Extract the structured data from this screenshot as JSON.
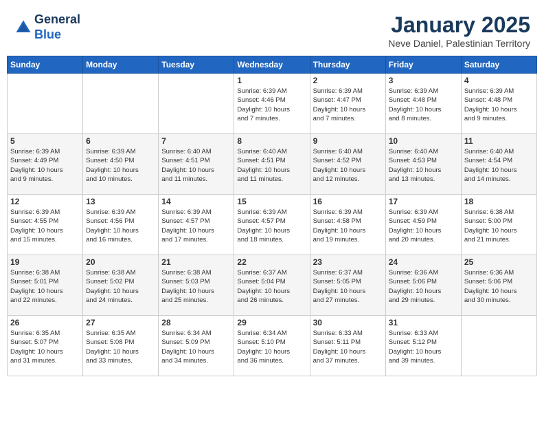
{
  "header": {
    "logo_line1": "General",
    "logo_line2": "Blue",
    "month": "January 2025",
    "location": "Neve Daniel, Palestinian Territory"
  },
  "weekdays": [
    "Sunday",
    "Monday",
    "Tuesday",
    "Wednesday",
    "Thursday",
    "Friday",
    "Saturday"
  ],
  "weeks": [
    [
      {
        "day": "",
        "info": ""
      },
      {
        "day": "",
        "info": ""
      },
      {
        "day": "",
        "info": ""
      },
      {
        "day": "1",
        "info": "Sunrise: 6:39 AM\nSunset: 4:46 PM\nDaylight: 10 hours\nand 7 minutes."
      },
      {
        "day": "2",
        "info": "Sunrise: 6:39 AM\nSunset: 4:47 PM\nDaylight: 10 hours\nand 7 minutes."
      },
      {
        "day": "3",
        "info": "Sunrise: 6:39 AM\nSunset: 4:48 PM\nDaylight: 10 hours\nand 8 minutes."
      },
      {
        "day": "4",
        "info": "Sunrise: 6:39 AM\nSunset: 4:48 PM\nDaylight: 10 hours\nand 9 minutes."
      }
    ],
    [
      {
        "day": "5",
        "info": "Sunrise: 6:39 AM\nSunset: 4:49 PM\nDaylight: 10 hours\nand 9 minutes."
      },
      {
        "day": "6",
        "info": "Sunrise: 6:39 AM\nSunset: 4:50 PM\nDaylight: 10 hours\nand 10 minutes."
      },
      {
        "day": "7",
        "info": "Sunrise: 6:40 AM\nSunset: 4:51 PM\nDaylight: 10 hours\nand 11 minutes."
      },
      {
        "day": "8",
        "info": "Sunrise: 6:40 AM\nSunset: 4:51 PM\nDaylight: 10 hours\nand 11 minutes."
      },
      {
        "day": "9",
        "info": "Sunrise: 6:40 AM\nSunset: 4:52 PM\nDaylight: 10 hours\nand 12 minutes."
      },
      {
        "day": "10",
        "info": "Sunrise: 6:40 AM\nSunset: 4:53 PM\nDaylight: 10 hours\nand 13 minutes."
      },
      {
        "day": "11",
        "info": "Sunrise: 6:40 AM\nSunset: 4:54 PM\nDaylight: 10 hours\nand 14 minutes."
      }
    ],
    [
      {
        "day": "12",
        "info": "Sunrise: 6:39 AM\nSunset: 4:55 PM\nDaylight: 10 hours\nand 15 minutes."
      },
      {
        "day": "13",
        "info": "Sunrise: 6:39 AM\nSunset: 4:56 PM\nDaylight: 10 hours\nand 16 minutes."
      },
      {
        "day": "14",
        "info": "Sunrise: 6:39 AM\nSunset: 4:57 PM\nDaylight: 10 hours\nand 17 minutes."
      },
      {
        "day": "15",
        "info": "Sunrise: 6:39 AM\nSunset: 4:57 PM\nDaylight: 10 hours\nand 18 minutes."
      },
      {
        "day": "16",
        "info": "Sunrise: 6:39 AM\nSunset: 4:58 PM\nDaylight: 10 hours\nand 19 minutes."
      },
      {
        "day": "17",
        "info": "Sunrise: 6:39 AM\nSunset: 4:59 PM\nDaylight: 10 hours\nand 20 minutes."
      },
      {
        "day": "18",
        "info": "Sunrise: 6:38 AM\nSunset: 5:00 PM\nDaylight: 10 hours\nand 21 minutes."
      }
    ],
    [
      {
        "day": "19",
        "info": "Sunrise: 6:38 AM\nSunset: 5:01 PM\nDaylight: 10 hours\nand 22 minutes."
      },
      {
        "day": "20",
        "info": "Sunrise: 6:38 AM\nSunset: 5:02 PM\nDaylight: 10 hours\nand 24 minutes."
      },
      {
        "day": "21",
        "info": "Sunrise: 6:38 AM\nSunset: 5:03 PM\nDaylight: 10 hours\nand 25 minutes."
      },
      {
        "day": "22",
        "info": "Sunrise: 6:37 AM\nSunset: 5:04 PM\nDaylight: 10 hours\nand 26 minutes."
      },
      {
        "day": "23",
        "info": "Sunrise: 6:37 AM\nSunset: 5:05 PM\nDaylight: 10 hours\nand 27 minutes."
      },
      {
        "day": "24",
        "info": "Sunrise: 6:36 AM\nSunset: 5:06 PM\nDaylight: 10 hours\nand 29 minutes."
      },
      {
        "day": "25",
        "info": "Sunrise: 6:36 AM\nSunset: 5:06 PM\nDaylight: 10 hours\nand 30 minutes."
      }
    ],
    [
      {
        "day": "26",
        "info": "Sunrise: 6:35 AM\nSunset: 5:07 PM\nDaylight: 10 hours\nand 31 minutes."
      },
      {
        "day": "27",
        "info": "Sunrise: 6:35 AM\nSunset: 5:08 PM\nDaylight: 10 hours\nand 33 minutes."
      },
      {
        "day": "28",
        "info": "Sunrise: 6:34 AM\nSunset: 5:09 PM\nDaylight: 10 hours\nand 34 minutes."
      },
      {
        "day": "29",
        "info": "Sunrise: 6:34 AM\nSunset: 5:10 PM\nDaylight: 10 hours\nand 36 minutes."
      },
      {
        "day": "30",
        "info": "Sunrise: 6:33 AM\nSunset: 5:11 PM\nDaylight: 10 hours\nand 37 minutes."
      },
      {
        "day": "31",
        "info": "Sunrise: 6:33 AM\nSunset: 5:12 PM\nDaylight: 10 hours\nand 39 minutes."
      },
      {
        "day": "",
        "info": ""
      }
    ]
  ]
}
